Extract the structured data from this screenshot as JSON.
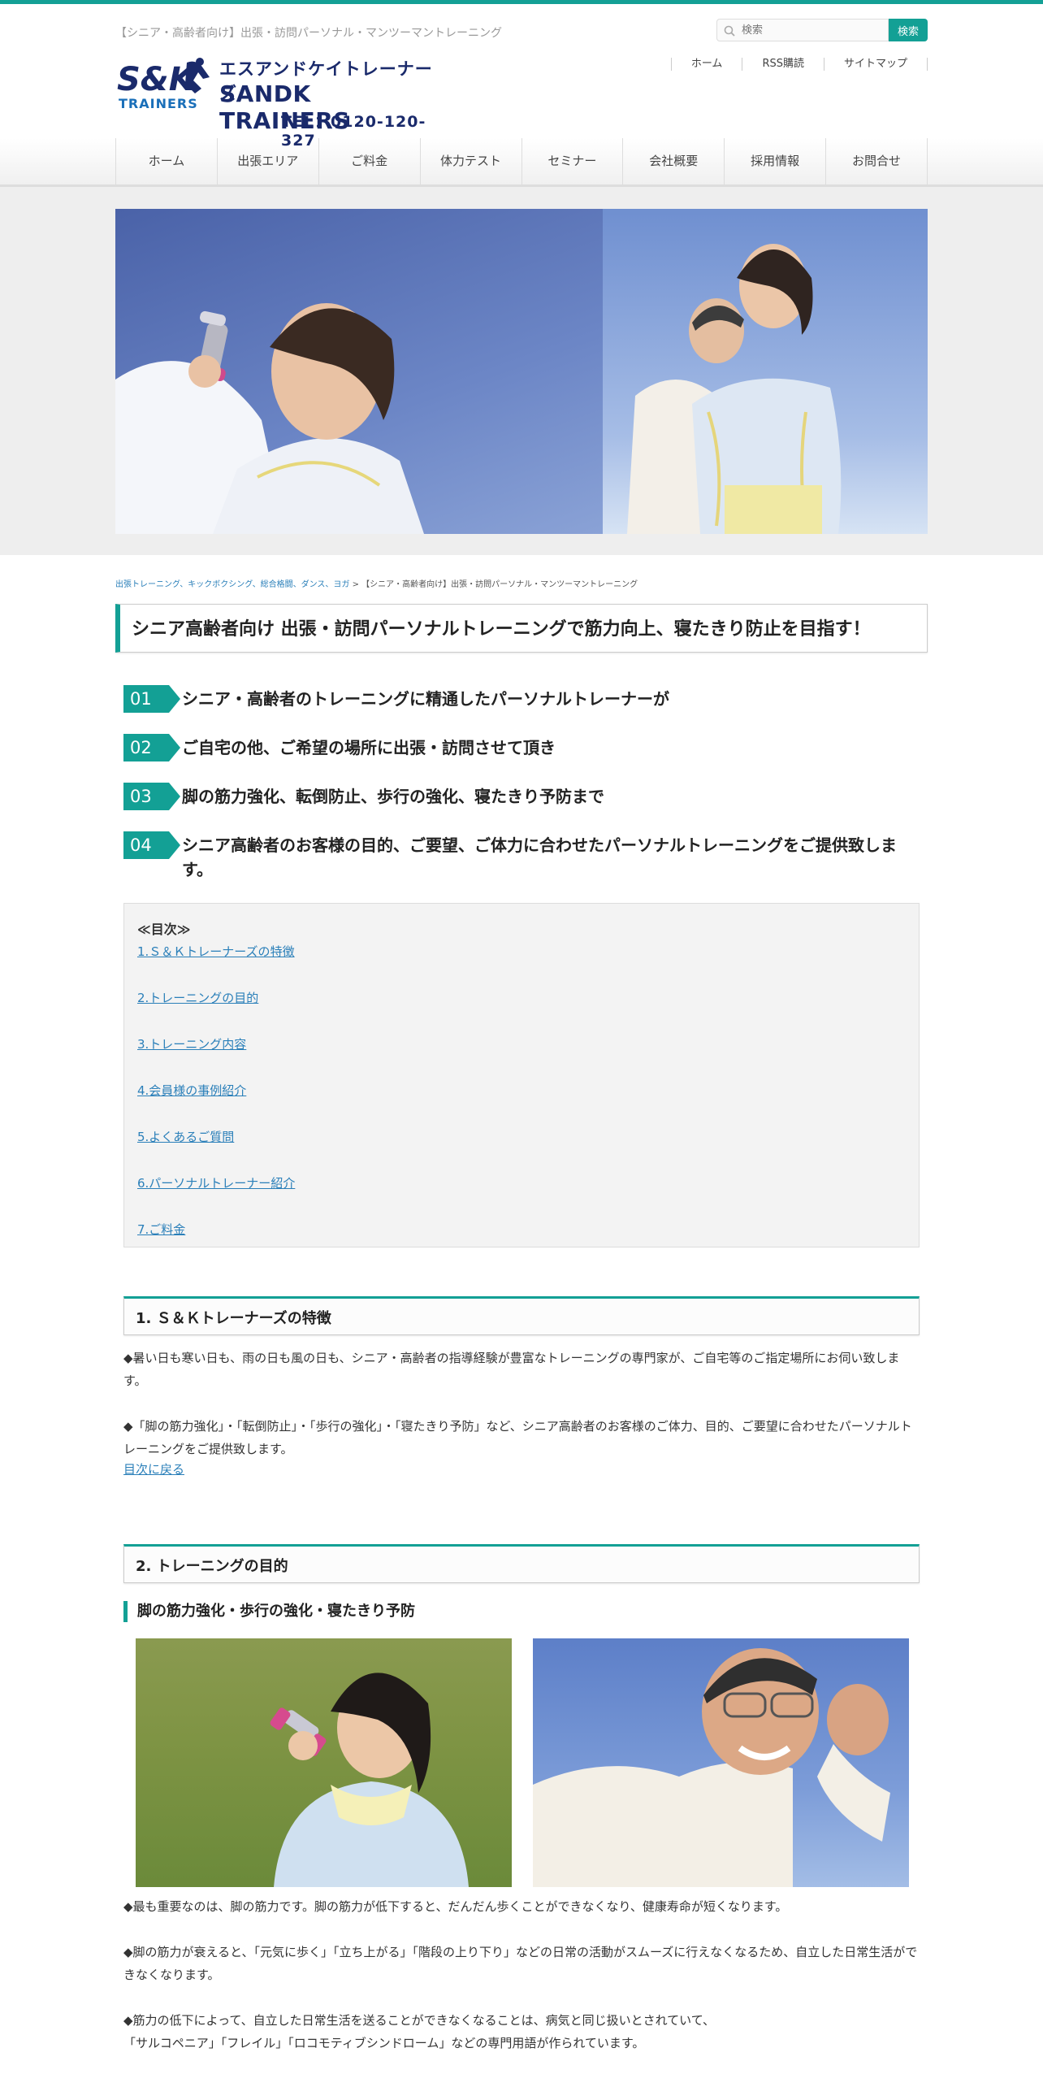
{
  "header": {
    "tagline": "【シニア・高齢者向け】出張・訪問パーソナル・マンツーマントレーニング",
    "logo_mark_text": "S&K",
    "logo_mark_sub": "TRAINERS",
    "logo_kana": "エスアンドケイトレーナーズ",
    "logo_en": "SANDK TRAINERS",
    "logo_tel": "TEL：0120-120-327",
    "search_placeholder": "検索",
    "search_button": "検索",
    "util_nav": [
      "ホーム",
      "RSS購読",
      "サイトマップ"
    ]
  },
  "global_nav": [
    "ホーム",
    "出張エリア",
    "ご料金",
    "体力テスト",
    "セミナー",
    "会社概要",
    "採用情報",
    "お問合せ"
  ],
  "breadcrumb": {
    "link": "出張トレーニング、キックボクシング、総合格闘、ダンス、ヨガ",
    "separator": ">",
    "current": "【シニア・高齢者向け】出張・訪問パーソナル・マンツーマントレーニング"
  },
  "page_title": "シニア高齢者向け 出張・訪問パーソナルトレーニングで筋力向上、寝たきり防止を目指す！",
  "points": [
    {
      "num": "01",
      "text": "シニア・高齢者のトレーニングに精通したパーソナルトレーナーが"
    },
    {
      "num": "02",
      "text": "ご自宅の他、ご希望の場所に出張・訪問させて頂き"
    },
    {
      "num": "03",
      "text": "脚の筋力強化、転倒防止、歩行の強化、寝たきり予防まで"
    },
    {
      "num": "04",
      "text": "シニア高齢者のお客様の目的、ご要望、ご体力に合わせたパーソナルトレーニングをご提供致します。"
    }
  ],
  "toc": {
    "title": "≪目次≫",
    "items": [
      "1.Ｓ＆Ｋトレーナーズの特徴",
      "2.トレーニングの目的",
      "3.トレーニング内容",
      "4.会員様の事例紹介",
      "5.よくあるご質問",
      "6.パーソナルトレーナー紹介",
      "7.ご料金"
    ]
  },
  "section1": {
    "heading": "1. Ｓ＆Ｋトレーナーズの特徴",
    "p1": "◆暑い日も寒い日も、雨の日も風の日も、シニア・高齢者の指導経験が豊富なトレーニングの専門家が、ご自宅等のご指定場所にお伺い致します。",
    "p2": "◆「脚の筋力強化」・「転倒防止」・「歩行の強化」・「寝たきり予防」など、シニア高齢者のお客様のご体力、目的、ご要望に合わせたパーソナルトレーニングをご提供致します。",
    "back": "目次に戻る"
  },
  "section2": {
    "heading": "2. トレーニングの目的",
    "subheading": "脚の筋力強化・歩行の強化・寝たきり予防",
    "p1": "◆最も重要なのは、脚の筋力です。脚の筋力が低下すると、だんだん歩くことができなくなり、健康寿命が短くなります。",
    "p2": "◆脚の筋力が衰えると、「元気に歩く」「立ち上がる」「階段の上り下り」などの日常の活動がスムーズに行えなくなるため、自立した日常生活ができなくなります。",
    "p3a": "◆筋力の低下によって、自立した日常生活を送ることができなくなることは、病気と同じ扱いとされていて、",
    "p3b": "「サルコペニア」「フレイル」「ロコモティブシンドローム」などの専門用語が作られています。"
  },
  "colors": {
    "accent": "#13a095",
    "link": "#2a7fb9",
    "logo_navy": "#1a2a6b"
  }
}
